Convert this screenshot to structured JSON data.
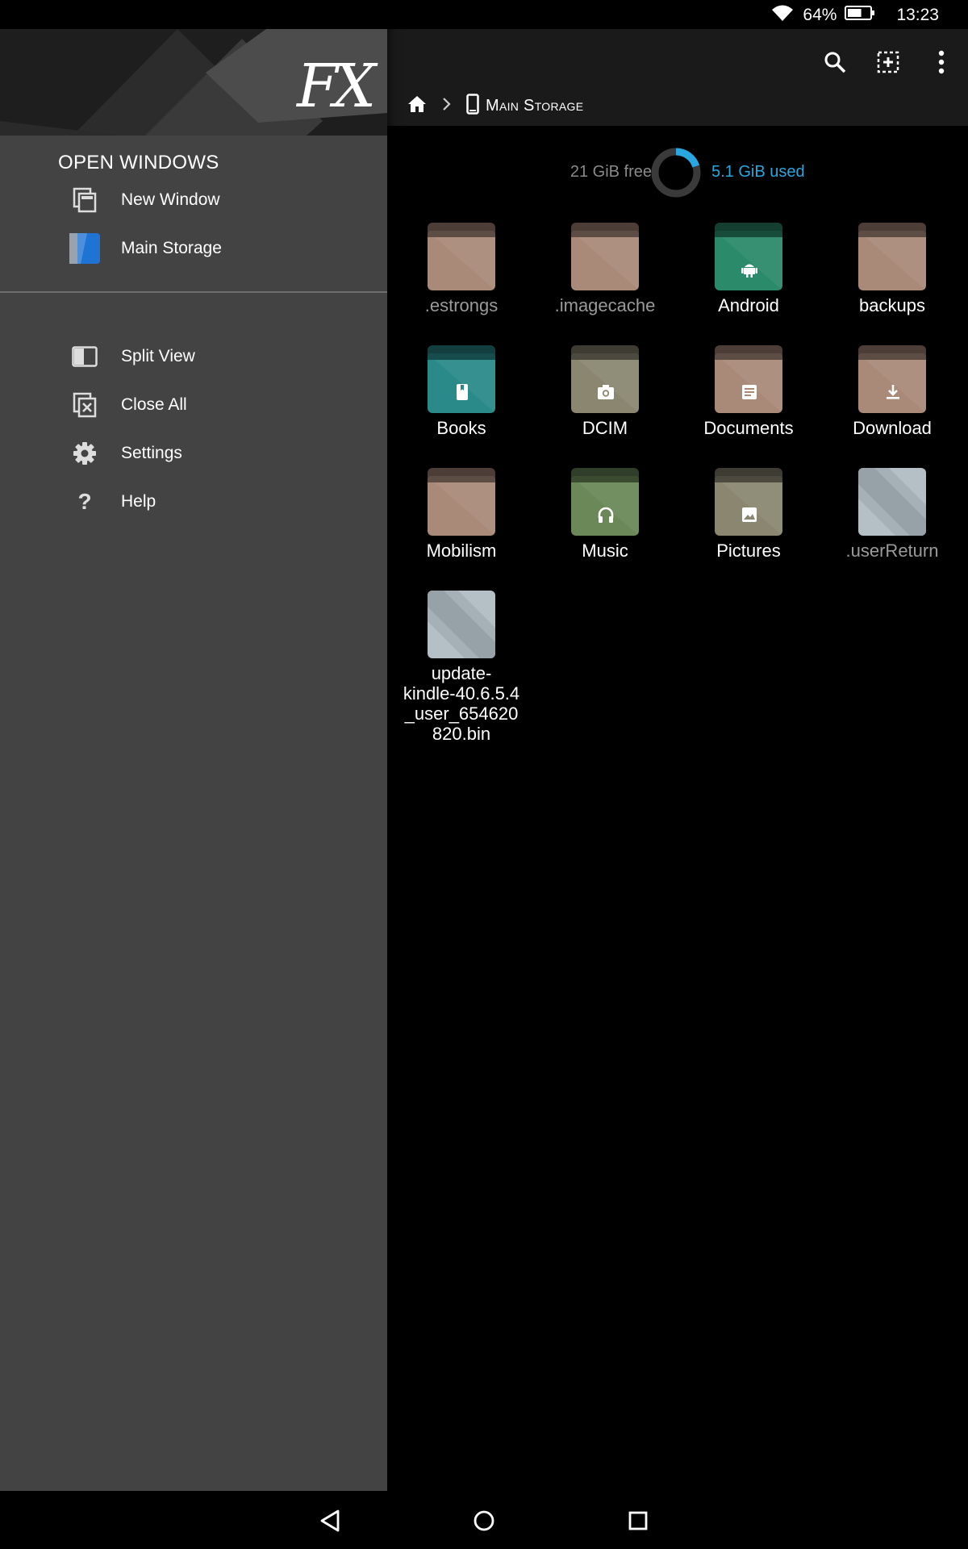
{
  "status_bar": {
    "notification_icons": [
      "more-dots-icon",
      "telegram-icon",
      "telegram-icon",
      "image-icon",
      "check-icon",
      "check-icon"
    ],
    "battery_percent": "64%",
    "battery_level": 0.64,
    "time": "13:23"
  },
  "drawer": {
    "logo_text": "FX",
    "section_title": "OPEN WINDOWS",
    "windows": [
      {
        "label": "New Window",
        "icon": "new-window-icon"
      },
      {
        "label": "Main Storage",
        "icon": "storage-icon"
      }
    ],
    "actions": [
      {
        "label": "Split View",
        "icon": "split-view-icon"
      },
      {
        "label": "Close All",
        "icon": "close-all-icon"
      },
      {
        "label": "Settings",
        "icon": "gear-icon"
      },
      {
        "label": "Help",
        "icon": "help-icon"
      }
    ]
  },
  "toolbar": {
    "buttons": [
      "search-icon",
      "select-icon",
      "more-vert-icon"
    ],
    "breadcrumb_location": "Main Storage"
  },
  "storage": {
    "free_text": "21 GiB free",
    "used_text": "5.1 GiB used",
    "used_fraction": 0.2,
    "used_color": "#29a7e1"
  },
  "items": [
    {
      "name": ".estrongs",
      "kind": "folder",
      "color": "#a98a79",
      "hidden": true,
      "badge": ""
    },
    {
      "name": ".imagecache",
      "kind": "folder",
      "color": "#a98a79",
      "hidden": true,
      "badge": ""
    },
    {
      "name": "Android",
      "kind": "folder",
      "color": "#2b8a6a",
      "hidden": false,
      "badge": "android"
    },
    {
      "name": "backups",
      "kind": "folder",
      "color": "#a98a79",
      "hidden": false,
      "badge": ""
    },
    {
      "name": "Books",
      "kind": "folder",
      "color": "#2a8a8a",
      "hidden": false,
      "badge": "book"
    },
    {
      "name": "DCIM",
      "kind": "folder",
      "color": "#8a8670",
      "hidden": false,
      "badge": "camera"
    },
    {
      "name": "Documents",
      "kind": "folder",
      "color": "#a98a79",
      "hidden": false,
      "badge": "doc"
    },
    {
      "name": "Download",
      "kind": "folder",
      "color": "#a98a79",
      "hidden": false,
      "badge": "download"
    },
    {
      "name": "Mobilism",
      "kind": "folder",
      "color": "#a98a79",
      "hidden": false,
      "badge": ""
    },
    {
      "name": "Music",
      "kind": "folder",
      "color": "#6a8858",
      "hidden": false,
      "badge": "music"
    },
    {
      "name": "Pictures",
      "kind": "folder",
      "color": "#8a8670",
      "hidden": false,
      "badge": "picture"
    },
    {
      "name": ".userReturn",
      "kind": "file",
      "color": "#b4c0c6",
      "hidden": true,
      "badge": ""
    },
    {
      "name": "update-kindle-40.6.5.4_user_654620820.bin",
      "display_lines": [
        "update-",
        "kindle-40.6.5.4",
        "_user_654620",
        "820.bin"
      ],
      "kind": "file",
      "color": "#b4c0c6",
      "hidden": false,
      "badge": ""
    }
  ],
  "nav_bar": {
    "buttons": [
      "back-icon",
      "home-icon",
      "recents-icon"
    ]
  }
}
